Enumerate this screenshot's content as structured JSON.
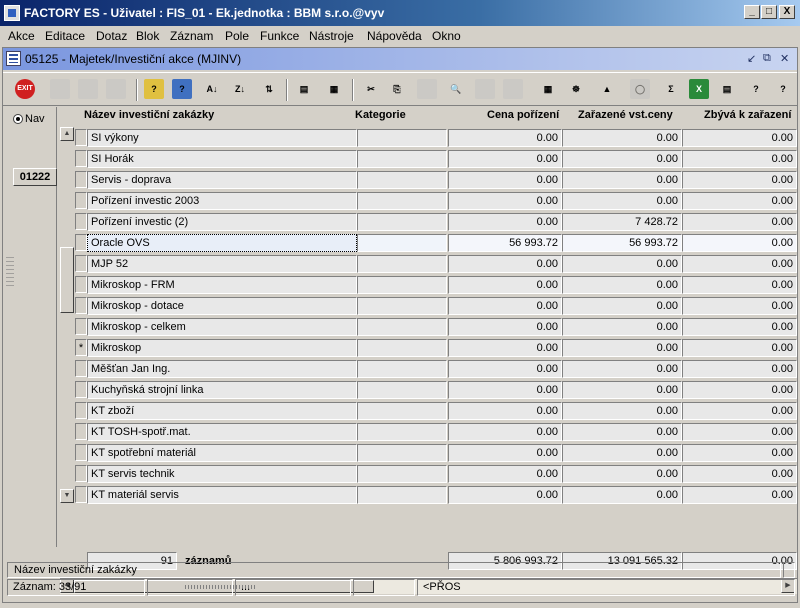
{
  "window": {
    "title": "FACTORY ES - Uživatel : FIS_01 - Ek.jednotka : BBM s.r.o.@vyv",
    "minimize": "_",
    "maximize": "□",
    "close": "X"
  },
  "menu": [
    "Akce",
    "Editace",
    "Dotaz",
    "Blok",
    "Záznam",
    "Pole",
    "Funkce",
    "Nástroje",
    "Nápověda",
    "Okno"
  ],
  "form": {
    "title": "05125 - Majetek/Investiční akce (MJINV)",
    "controls": [
      "↙",
      "⧉",
      "✕"
    ]
  },
  "toolbar": [
    {
      "icon": "exit-icon",
      "label": "EXIT",
      "color": "#d02020",
      "enabled": true
    },
    {
      "icon": "save-icon",
      "label": "",
      "color": "#c0c0c0",
      "enabled": false
    },
    {
      "icon": "print-form-icon",
      "label": "",
      "color": "#c0c0c0",
      "enabled": false
    },
    {
      "icon": "clear-icon",
      "label": "",
      "color": "#c0c0c0",
      "enabled": false
    },
    {
      "icon": "query-enter-icon",
      "label": "?",
      "color": "#e0c040",
      "enabled": true
    },
    {
      "icon": "query-execute-icon",
      "label": "?",
      "color": "#4070c0",
      "enabled": true
    },
    {
      "icon": "sort-asc-icon",
      "label": "A↓",
      "color": "#d4d0c8",
      "enabled": true
    },
    {
      "icon": "sort-desc-icon",
      "label": "Z↓",
      "color": "#d4d0c8",
      "enabled": true
    },
    {
      "icon": "sort-multi-icon",
      "label": "⇅",
      "color": "#d4d0c8",
      "enabled": true
    },
    {
      "icon": "printer-icon",
      "label": "▤",
      "color": "#d4d0c8",
      "enabled": true
    },
    {
      "icon": "report-icon",
      "label": "▦",
      "color": "#d4d0c8",
      "enabled": true
    },
    {
      "icon": "cut-icon",
      "label": "✂",
      "color": "#d4d0c8",
      "enabled": true
    },
    {
      "icon": "paste-icon",
      "label": "⎘",
      "color": "#d4d0c8",
      "enabled": true
    },
    {
      "icon": "copy-record-icon",
      "label": "",
      "color": "#c0c0c0",
      "enabled": false
    },
    {
      "icon": "find-icon",
      "label": "🔍",
      "color": "#d4d0c8",
      "enabled": true
    },
    {
      "icon": "insert-row-icon",
      "label": "",
      "color": "#c0c0c0",
      "enabled": false
    },
    {
      "icon": "delete-row-icon",
      "label": "",
      "color": "#c0c0c0",
      "enabled": false
    },
    {
      "icon": "calculator-icon",
      "label": "▦",
      "color": "#d4d0c8",
      "enabled": true
    },
    {
      "icon": "wheel-icon",
      "label": "☸",
      "color": "#d4d0c8",
      "enabled": true
    },
    {
      "icon": "mountain-icon",
      "label": "▲",
      "color": "#d4d0c8",
      "enabled": true
    },
    {
      "icon": "disk-icon",
      "label": "◯",
      "color": "#c0c0c0",
      "enabled": false
    },
    {
      "icon": "sum-icon",
      "label": "Σ",
      "color": "#d4d0c8",
      "enabled": true
    },
    {
      "icon": "excel-icon",
      "label": "X",
      "color": "#2a8a3a",
      "enabled": true
    },
    {
      "icon": "export-icon",
      "label": "▤",
      "color": "#d4d0c8",
      "enabled": true
    },
    {
      "icon": "help-icon",
      "label": "?",
      "color": "#d4d0c8",
      "enabled": true
    },
    {
      "icon": "info-icon",
      "label": "?",
      "color": "#d4d0c8",
      "enabled": true
    }
  ],
  "nav": {
    "label": "Nav",
    "code": "01222"
  },
  "columns": {
    "name": "Název investiční zakázky",
    "category": "Kategorie",
    "cost": "Cena pořízení",
    "included": "Zařazené vst.ceny",
    "remaining": "Zbývá k zařazení"
  },
  "rows": [
    {
      "marker": "",
      "name": "SI výkony",
      "category": "",
      "cost": "0.00",
      "included": "0.00",
      "remaining": "0.00"
    },
    {
      "marker": "",
      "name": "SI Horák",
      "category": "",
      "cost": "0.00",
      "included": "0.00",
      "remaining": "0.00"
    },
    {
      "marker": "",
      "name": "Servis - doprava",
      "category": "",
      "cost": "0.00",
      "included": "0.00",
      "remaining": "0.00"
    },
    {
      "marker": "",
      "name": "Pořízení investic 2003",
      "category": "",
      "cost": "0.00",
      "included": "0.00",
      "remaining": "0.00"
    },
    {
      "marker": "",
      "name": "Pořízení investic (2)",
      "category": "",
      "cost": "0.00",
      "included": "7 428.72",
      "remaining": "0.00"
    },
    {
      "marker": "",
      "name": "Oracle OVS",
      "category": "",
      "cost": "56 993.72",
      "included": "56 993.72",
      "remaining": "0.00",
      "selected": true
    },
    {
      "marker": "",
      "name": "MJP 52",
      "category": "",
      "cost": "0.00",
      "included": "0.00",
      "remaining": "0.00"
    },
    {
      "marker": "",
      "name": "Mikroskop - FRM",
      "category": "",
      "cost": "0.00",
      "included": "0.00",
      "remaining": "0.00"
    },
    {
      "marker": "",
      "name": "Mikroskop - dotace",
      "category": "",
      "cost": "0.00",
      "included": "0.00",
      "remaining": "0.00"
    },
    {
      "marker": "",
      "name": "Mikroskop - celkem",
      "category": "",
      "cost": "0.00",
      "included": "0.00",
      "remaining": "0.00"
    },
    {
      "marker": "*",
      "name": "Mikroskop",
      "category": "",
      "cost": "0.00",
      "included": "0.00",
      "remaining": "0.00"
    },
    {
      "marker": "",
      "name": "Měšťan Jan Ing.",
      "category": "",
      "cost": "0.00",
      "included": "0.00",
      "remaining": "0.00"
    },
    {
      "marker": "",
      "name": "Kuchyňská strojní linka",
      "category": "",
      "cost": "0.00",
      "included": "0.00",
      "remaining": "0.00"
    },
    {
      "marker": "",
      "name": "KT zboží",
      "category": "",
      "cost": "0.00",
      "included": "0.00",
      "remaining": "0.00"
    },
    {
      "marker": "",
      "name": "KT TOSH-spotř.mat.",
      "category": "",
      "cost": "0.00",
      "included": "0.00",
      "remaining": "0.00"
    },
    {
      "marker": "",
      "name": "KT spotřební materiál",
      "category": "",
      "cost": "0.00",
      "included": "0.00",
      "remaining": "0.00"
    },
    {
      "marker": "",
      "name": "KT servis technik",
      "category": "",
      "cost": "0.00",
      "included": "0.00",
      "remaining": "0.00"
    },
    {
      "marker": "",
      "name": "KT materiál servis",
      "category": "",
      "cost": "0.00",
      "included": "0.00",
      "remaining": "0.00"
    }
  ],
  "summary": {
    "count": "91",
    "count_label": "záznamů",
    "cost": "5 806 993.72",
    "included": "13 091 565.32",
    "remaining": "0.00"
  },
  "status": {
    "hint": "Název investiční zakázky",
    "record": "Záznam: 33/91",
    "segment2": "",
    "segment3": "...",
    "segment4": "",
    "mode": "<PŘOS"
  }
}
